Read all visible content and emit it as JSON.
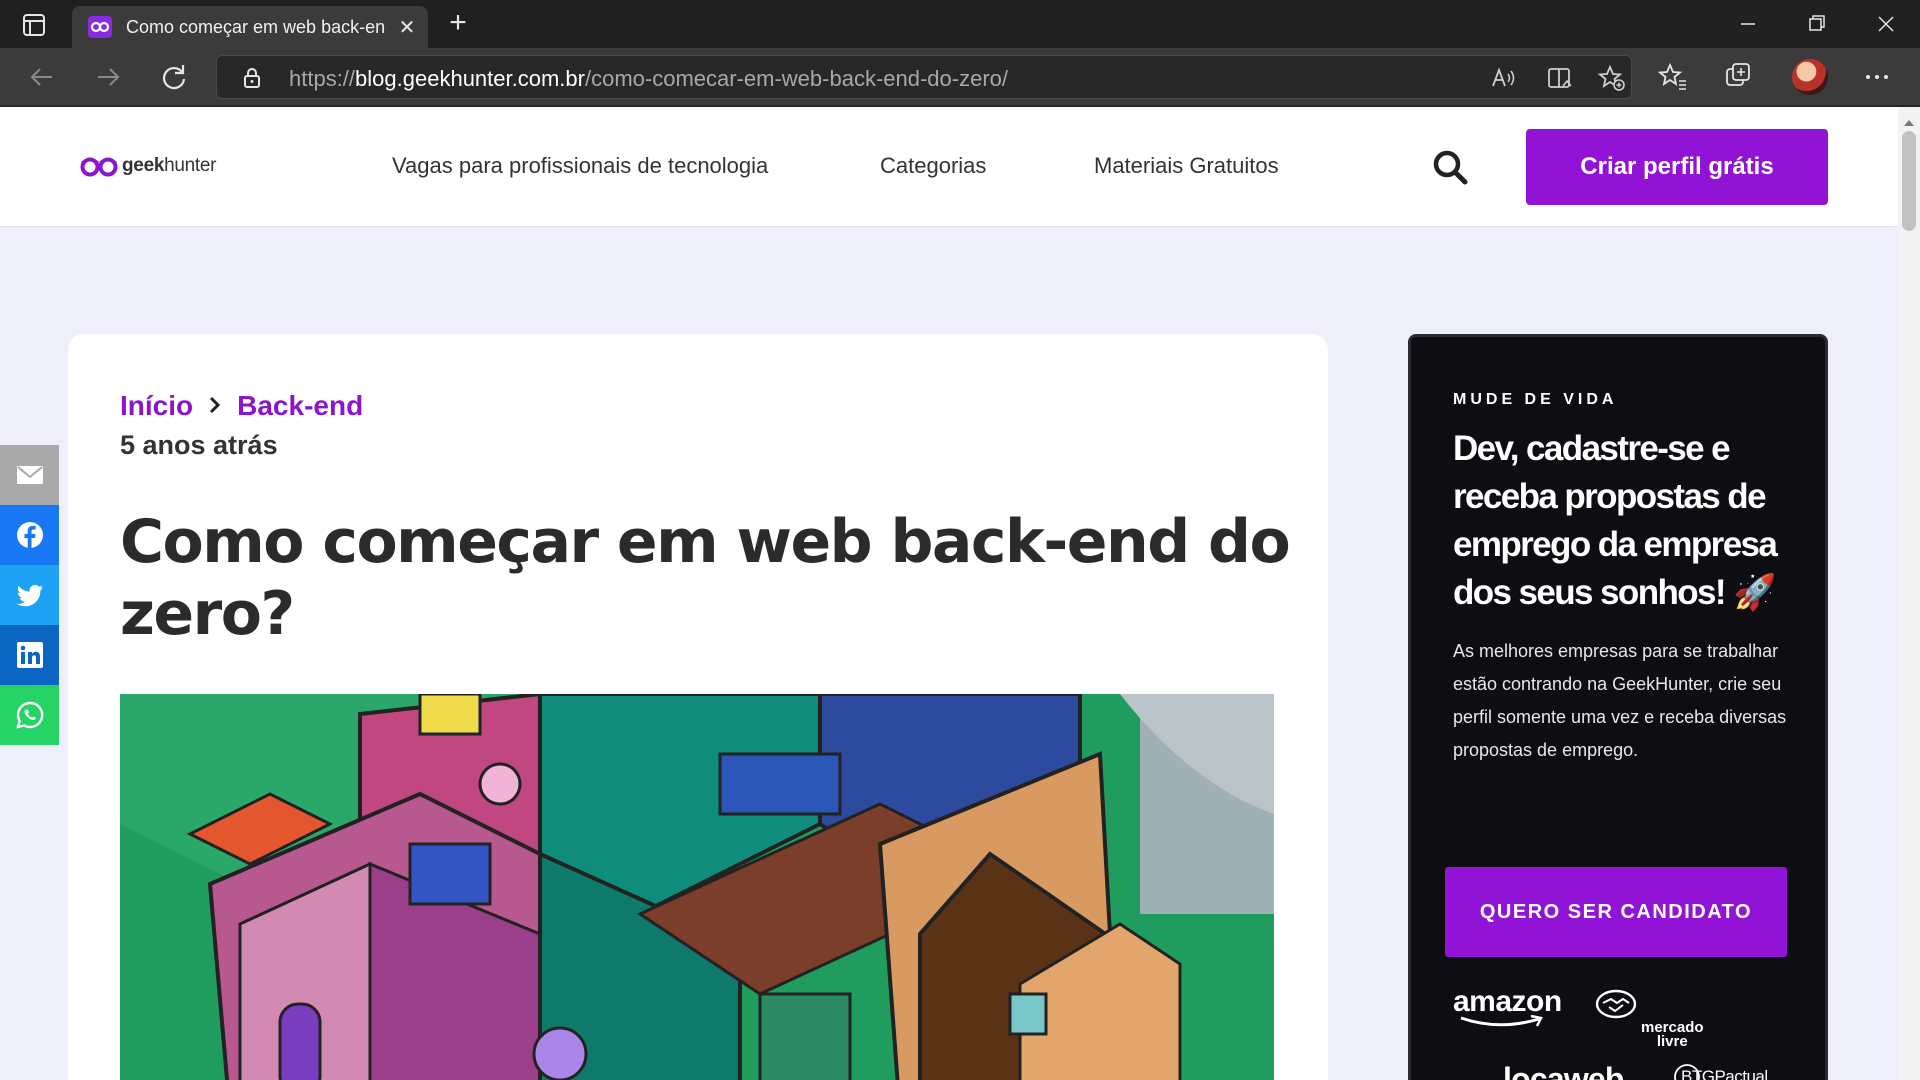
{
  "browser": {
    "tab_title": "Como começar em web back-end do zero?",
    "url_prefix": "https://",
    "url_host": "blog.geekhunter.com.br",
    "url_path": "/como-comecar-em-web-back-end-do-zero/",
    "accent": "#9114d6"
  },
  "site": {
    "logo_text_bold": "geek",
    "logo_text": "hunter",
    "nav": [
      "Vagas para profissionais de tecnologia",
      "Categorias",
      "Materiais Gratuitos"
    ],
    "cta_label": "Criar perfil grátis"
  },
  "article": {
    "breadcrumb": [
      "Início",
      "Back-end"
    ],
    "date": "5 anos atrás",
    "title": "Como começar em web back-end do zero?"
  },
  "share": [
    "email-icon",
    "facebook-icon",
    "twitter-icon",
    "linkedin-icon",
    "whatsapp-icon"
  ],
  "promo": {
    "eyebrow": "MUDE DE VIDA",
    "title": "Dev, cadastre-se e receba propostas de emprego da empresa dos seus sonhos! 🚀",
    "body": "As melhores empresas para se trabalhar estão contrando na GeekHunter, crie seu perfil somente uma vez e receba diversas propostas de emprego.",
    "cta_label": "QUERO SER CANDIDATO",
    "brands": [
      "amazon",
      "mercado\nlivre",
      "locaweb",
      "BTGPactual"
    ]
  }
}
